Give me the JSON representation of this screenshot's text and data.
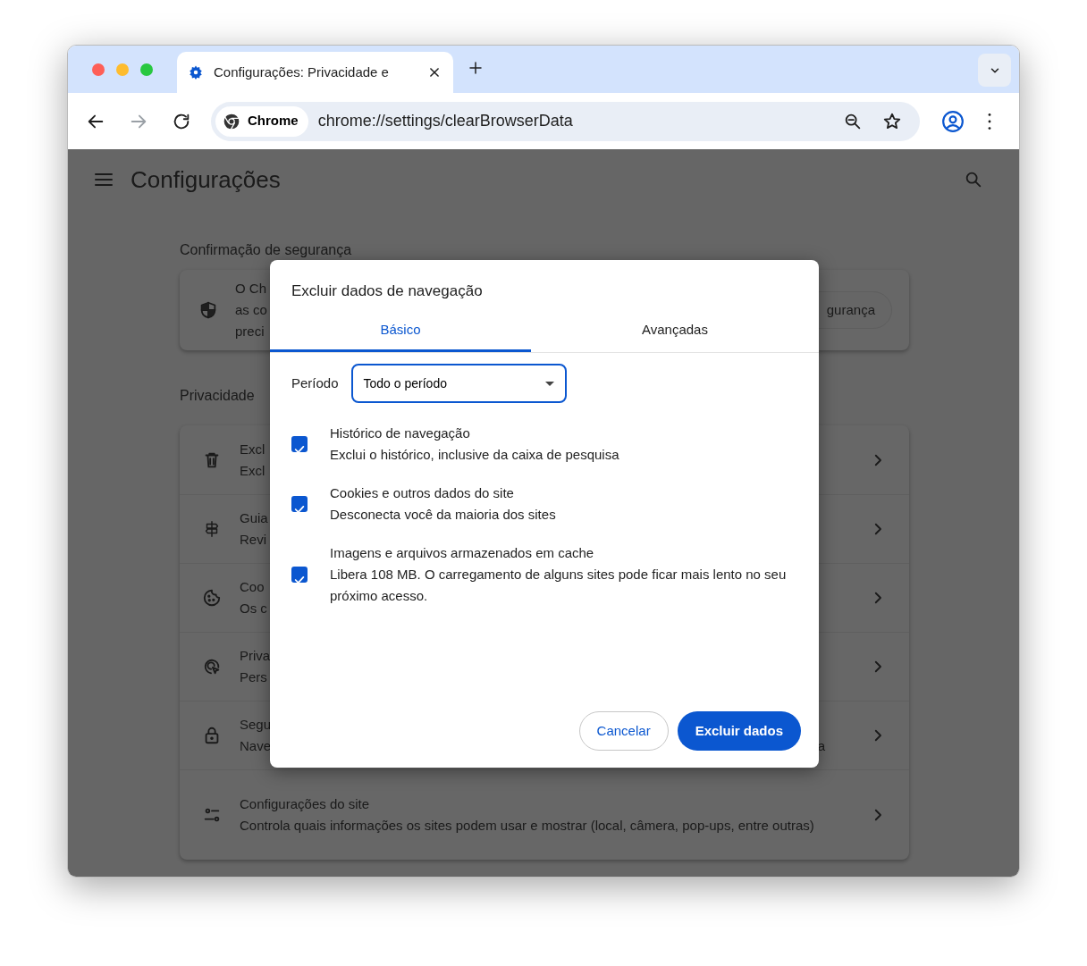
{
  "tabs": [
    {
      "title": "Configurações: Privacidade e",
      "selected": true
    }
  ],
  "nav_buttons": [
    {
      "kind": "back",
      "disabled": false
    },
    {
      "kind": "forward",
      "disabled": true
    },
    {
      "kind": "reload",
      "disabled": false
    }
  ],
  "omnibox": {
    "chip": "Chrome",
    "url": "chrome://settings/clearBrowserData"
  },
  "settings": {
    "title": "Configurações",
    "safety": {
      "heading": "Confirmação de segurança",
      "lines": [
        "O Ch",
        "as co",
        "preci"
      ],
      "button": "gurança"
    },
    "privacy": {
      "heading": "Privacidade",
      "rows": [
        {
          "kind": "trash",
          "lines": [
            "Excl",
            "Excl"
          ]
        },
        {
          "kind": "guide",
          "lines": [
            "Guia",
            "Revi"
          ]
        },
        {
          "kind": "cookie",
          "lines": [
            "Coo",
            "Os c"
          ]
        },
        {
          "kind": "ads",
          "lines": [
            "Priva",
            "Pers"
          ]
        },
        {
          "kind": "lock",
          "lines": [
            "Segu",
            "Nave"
          ],
          "right_text": "a"
        },
        {
          "kind": "site",
          "lines": [
            "Configurações do site",
            "Controla quais informações os sites podem usar e mostrar (local, câmera, pop-ups, entre outras)"
          ]
        }
      ]
    }
  },
  "dialog": {
    "title": "Excluir dados de navegação",
    "tabs": [
      {
        "label": "Básico",
        "selected": true
      },
      {
        "label": "Avançadas",
        "selected": false
      }
    ],
    "period": {
      "label": "Período",
      "value": "Todo o período"
    },
    "items": [
      {
        "title": "Histórico de navegação",
        "description": "Exclui o histórico, inclusive da caixa de pesquisa",
        "checked": true
      },
      {
        "title": "Cookies e outros dados do site",
        "description": "Desconecta você da maioria dos sites",
        "checked": true
      },
      {
        "title": "Imagens e arquivos armazenados em cache",
        "description": "Libera 108 MB. O carregamento de alguns sites pode ficar mais lento no seu próximo acesso.",
        "checked": true
      }
    ],
    "buttons": [
      {
        "kind": "secondary",
        "label": "Cancelar"
      },
      {
        "kind": "primary",
        "label": "Excluir dados"
      }
    ]
  }
}
